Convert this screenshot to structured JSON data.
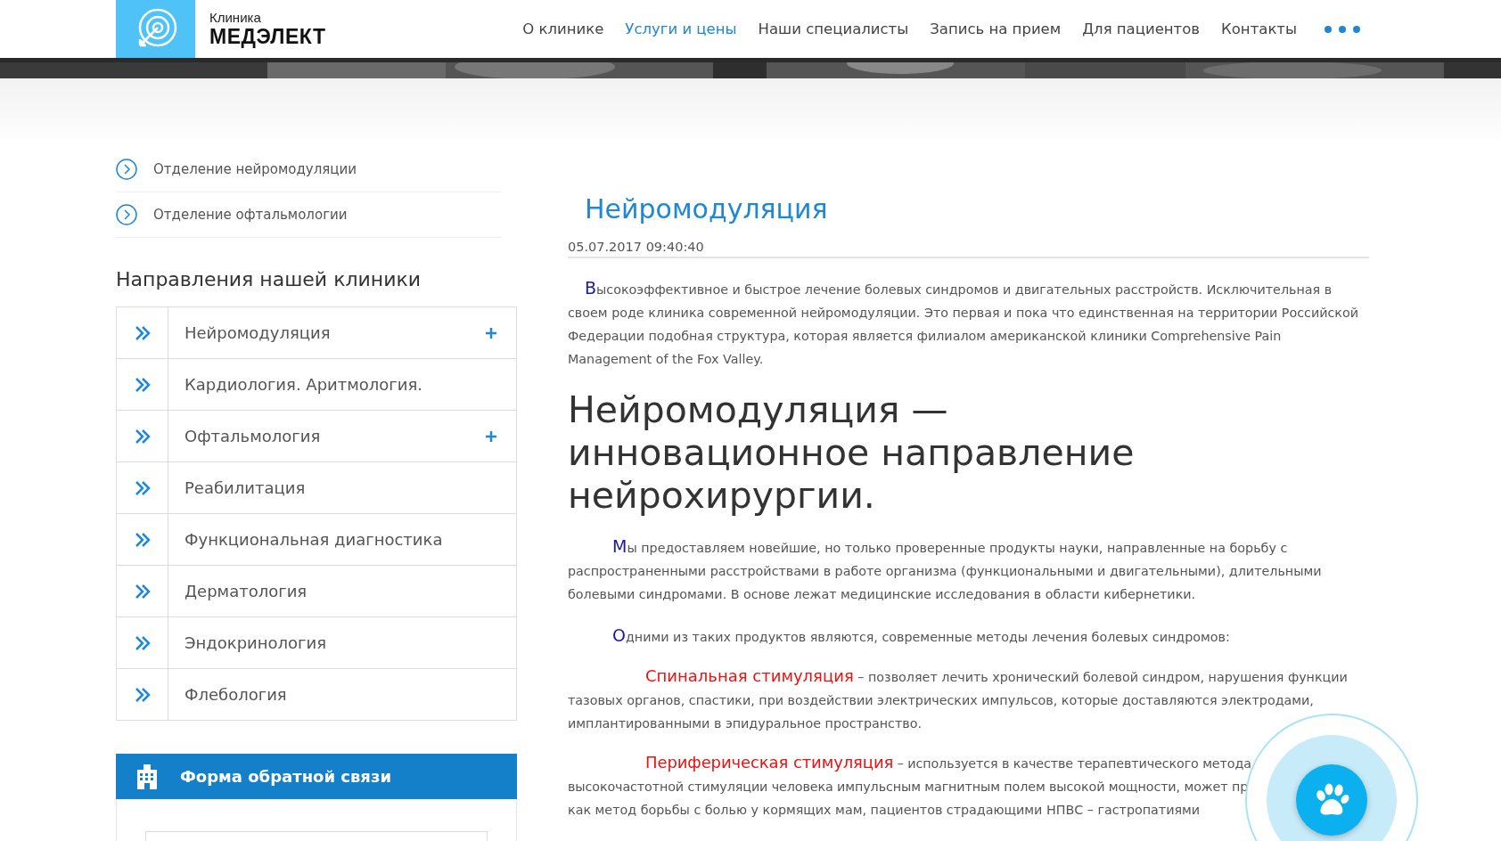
{
  "header": {
    "logo": {
      "line1": "Клиника",
      "line2": "МЕДЭЛЕКТ"
    },
    "nav": [
      {
        "label": "О клинике",
        "selected": false
      },
      {
        "label": "Услуги и цены",
        "selected": true
      },
      {
        "label": "Наши специалисты",
        "selected": false
      },
      {
        "label": "Запись на прием",
        "selected": false
      },
      {
        "label": "Для пациентов",
        "selected": false
      },
      {
        "label": "Контакты",
        "selected": false
      }
    ]
  },
  "sidebar": {
    "links": [
      "Отделение нейромодуляции",
      "Отделение офтальмологии"
    ],
    "heading": "Направления нашей клиники",
    "items": [
      {
        "label": "Нейромодуляция",
        "expandable": true
      },
      {
        "label": "Кардиология. Аритмология.",
        "expandable": false
      },
      {
        "label": "Офтальмология",
        "expandable": true
      },
      {
        "label": "Реабилитация",
        "expandable": false
      },
      {
        "label": "Функциональная диагностика",
        "expandable": false
      },
      {
        "label": "Дерматология",
        "expandable": false
      },
      {
        "label": "Эндокринология",
        "expandable": false
      },
      {
        "label": "Флебология",
        "expandable": false
      }
    ],
    "form": {
      "title": "Форма обратной связи"
    }
  },
  "article": {
    "title": "Нейромодуляция",
    "date": "05.07.2017 09:40:40",
    "intro": "Высокоэффективное и быстрое лечение болевых синдромов и двигательных расстройств. Исключительная в своем роде клиника современной нейромодуляции. Это первая и пока что единственная на территории Российской Федерации подобная структура, которая является филиалом американской клиники Comprehensive Pain Management of the Fox Valley.",
    "heading": "Нейромодуляция — инновационное направление нейрохирургии.",
    "paragraphs": [
      "Мы предоставляем новейшие, но только проверенные продукты науки, направленные на борьбу с распространенными расстройствами в работе организма (функциональными и двигательными), длительными болевыми синдромами. В основе лежат медицинские исследования в области кибернетики.",
      "Одними из таких продуктов являются, современные методы лечения болевых синдромов:"
    ],
    "methods": [
      {
        "term": "Спинальная стимуляция",
        "text": " – позволяет лечить хронический болевой синдром, нарушения функции тазовых органов, спастики, при воздействии электрических импульсов, которые доставляются электродами, имплантированными в эпидуральное пространство."
      },
      {
        "term": "Периферическая стимуляция",
        "text": " – используется в качестве терапевтического метода высокочастотной стимуляции человека импульсным магнитным полем высокой мощности, может пр"
      }
    ],
    "cut_line": "как метод борьбы с болью у кормящих мам, пациентов страдающими НПВС – гастропатиями"
  }
}
